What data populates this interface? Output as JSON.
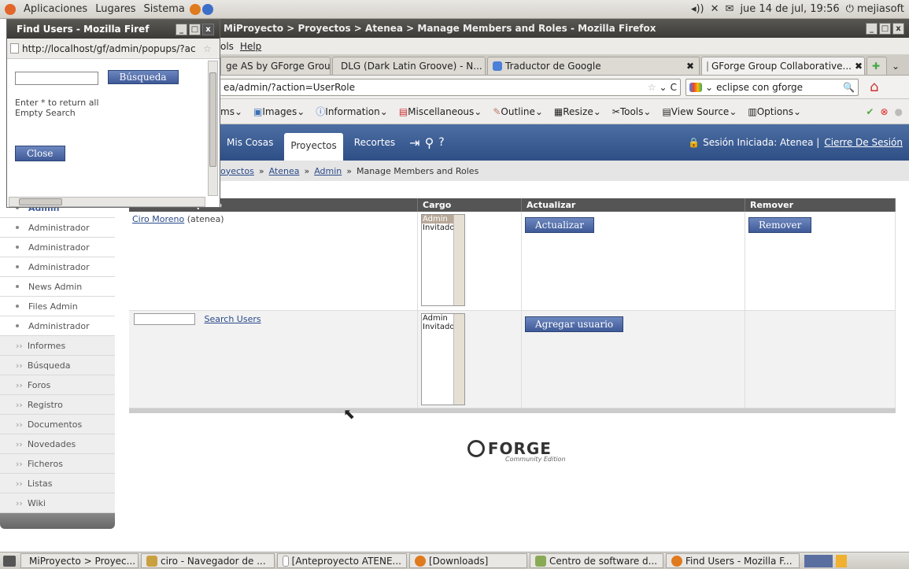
{
  "topbar": {
    "menus": [
      "Aplicaciones",
      "Lugares",
      "Sistema"
    ],
    "datetime": "jue 14 de jul, 19:56",
    "user": "mejiasoft"
  },
  "window": {
    "title": "MiProyecto > Proyectos > Atenea > Manage Members and Roles - Mozilla Firefox",
    "menus": [
      "ols",
      "Help"
    ],
    "tabs": [
      "ge AS by GForge Group...",
      "DLG (Dark Latin Groove) - N...",
      "Traductor de Google",
      "GForge Group Collaborative..."
    ],
    "url": "ea/admin/?action=UserRole",
    "search": "eclipse con gforge",
    "toolbar": [
      "ms",
      "Images",
      "Information",
      "Miscellaneous",
      "Outline",
      "Resize",
      "Tools",
      "View Source",
      "Options"
    ]
  },
  "site": {
    "nav": [
      "Mis Cosas",
      "Proyectos",
      "Recortes"
    ],
    "session_label": "Sesión Iniciada: Atenea |",
    "logout": "Cierre De Sesión",
    "breadcrumb": [
      "oyectos",
      "Atenea",
      "Admin",
      "Manage Members and Roles"
    ]
  },
  "sidebar": {
    "admin": "Admin",
    "items": [
      "Administrador",
      "Administrador",
      "Administrador",
      "News Admin",
      "Files Admin",
      "Administrador"
    ],
    "sections": [
      "Informes",
      "Búsqueda",
      "Foros",
      "Registro",
      "Documentos",
      "Novedades",
      "Ficheros",
      "Listas",
      "Wiki"
    ]
  },
  "table": {
    "headers": [
      "Nombre Completo",
      "Cargo",
      "Actualizar",
      "Remover"
    ],
    "member": {
      "name": "Ciro Moreno",
      "login": "(atenea)"
    },
    "roles": [
      "Admin",
      "Invitado"
    ],
    "update_btn": "Actualizar",
    "remove_btn": "Remover",
    "search_link": "Search Users",
    "add_btn": "Agregar usuario"
  },
  "logo": {
    "name": "FORGE",
    "sub": "Community Edition"
  },
  "popup": {
    "title": "Find Users - Mozilla Firef",
    "url": "http://localhost/gf/admin/popups/?ac",
    "search_btn": "Búsqueda",
    "hint1": "Enter * to return all",
    "hint2": "Empty Search",
    "close": "Close"
  },
  "taskbar": [
    "MiProyecto > Proyec...",
    "ciro - Navegador de ...",
    "[Anteproyecto ATENE...",
    "[Downloads]",
    "Centro de software d...",
    "Find Users - Mozilla F..."
  ]
}
